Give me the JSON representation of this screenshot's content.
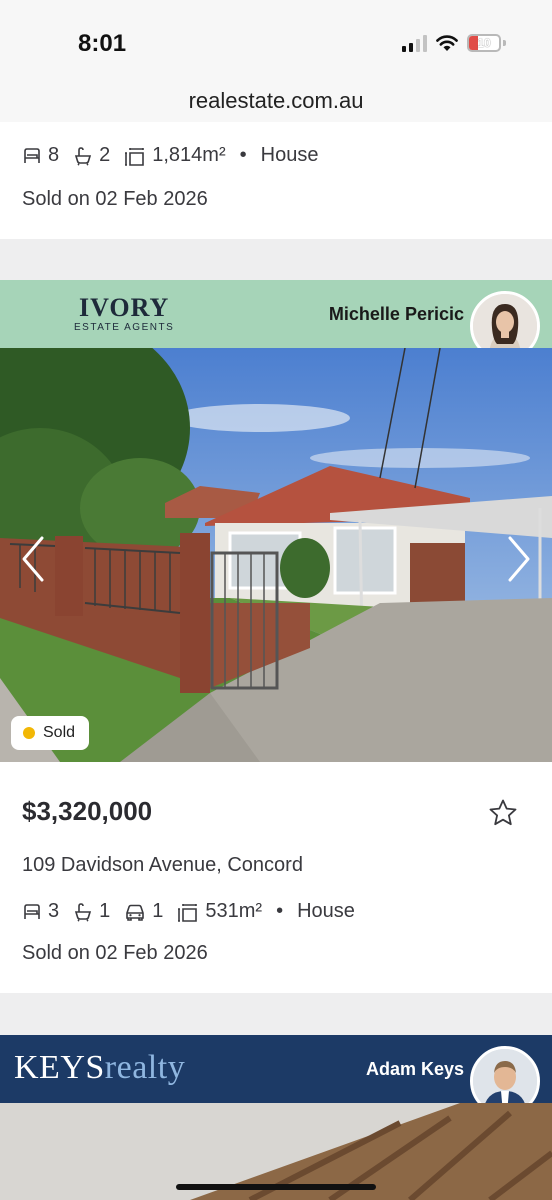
{
  "status_bar": {
    "time": "8:01",
    "battery": "10",
    "battery_color": "#e04c47"
  },
  "browser": {
    "url": "realestate.com.au"
  },
  "listings": [
    {
      "beds": "8",
      "baths": "2",
      "land": "1,814m²",
      "type": "House",
      "sold_date": "Sold on 02 Feb 2026"
    },
    {
      "agency": {
        "name": "IVORY",
        "subtitle": "ESTATE AGENTS",
        "color": "#a6d4b8"
      },
      "agent": "Michelle Pericic",
      "badge": "Sold",
      "price": "$3,320,000",
      "address": "109 Davidson Avenue, Concord",
      "beds": "3",
      "baths": "1",
      "cars": "1",
      "land": "531m²",
      "type": "House",
      "sold_date": "Sold on 02 Feb 2026"
    },
    {
      "agency": {
        "name_part1": "KEYS",
        "name_part2": "realty",
        "color": "#1c3a66"
      },
      "agent": "Adam Keys"
    }
  ],
  "icons": [
    "bed-icon",
    "bath-icon",
    "car-icon",
    "land-size-icon",
    "star-icon",
    "chevron-left-icon",
    "chevron-right-icon",
    "wifi-icon",
    "signal-icon",
    "battery-icon"
  ]
}
